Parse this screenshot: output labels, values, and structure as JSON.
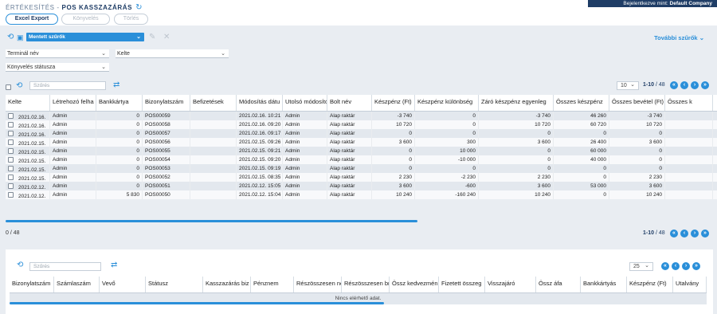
{
  "header": {
    "crumb_parent": "ÉRTÉKESÍTÉS",
    "crumb_sep": " - ",
    "crumb_current": "POS KASSZAZÁRÁS",
    "login_prefix": "Bejelentkezve mint: ",
    "login_user": "Default Company"
  },
  "toolbar": {
    "excel": "Excel Export",
    "book": "Könyvelés",
    "delete": "Törlés"
  },
  "filters": {
    "saved": "Mentett szűrők",
    "more": "További szűrők",
    "terminal": "Terminál név",
    "date": "Kelte",
    "status": "Könyvelés státusza"
  },
  "grid": {
    "search_placeholder": "Szűrés",
    "page_size": "10",
    "range": "1-10",
    "total": " / 48",
    "footer_count": "0  /  48",
    "columns": [
      "Kelte",
      "Létrehozó felha",
      "Bankkártya",
      "Bizonylatszám",
      "Befizetések",
      "Módosítás dátu",
      "Utolsó módosító",
      "Bolt név",
      "Készpénz (Ft)",
      "Készpénz különbség",
      "Záró készpénz egyenleg",
      "Összes készpénz",
      "Összes bevétel (Ft)",
      "Összes k"
    ],
    "rows": [
      [
        "2021.02.16.",
        "Admin",
        "0",
        "POS00059",
        "",
        "2021.02.16. 10:21",
        "Admin",
        "Alap raktár",
        "-3 740",
        "0",
        "-3 740",
        "46 260",
        "-3 740",
        ""
      ],
      [
        "2021.02.16.",
        "Admin",
        "0",
        "POS00058",
        "",
        "2021.02.16. 09:20",
        "Admin",
        "Alap raktár",
        "10 720",
        "0",
        "10 720",
        "60 720",
        "10 720",
        ""
      ],
      [
        "2021.02.16.",
        "Admin",
        "0",
        "POS00057",
        "",
        "2021.02.16. 09:17",
        "Admin",
        "Alap raktár",
        "0",
        "0",
        "0",
        "0",
        "0",
        ""
      ],
      [
        "2021.02.15.",
        "Admin",
        "0",
        "POS00056",
        "",
        "2021.02.15. 09:26",
        "Admin",
        "Alap raktár",
        "3 600",
        "300",
        "3 600",
        "26 400",
        "3 600",
        ""
      ],
      [
        "2021.02.15.",
        "Admin",
        "0",
        "POS00055",
        "",
        "2021.02.15. 09:21",
        "Admin",
        "Alap raktár",
        "0",
        "10 000",
        "0",
        "60 000",
        "0",
        ""
      ],
      [
        "2021.02.15.",
        "Admin",
        "0",
        "POS00054",
        "",
        "2021.02.15. 09:20",
        "Admin",
        "Alap raktár",
        "0",
        "-10 000",
        "0",
        "40 000",
        "0",
        ""
      ],
      [
        "2021.02.15.",
        "Admin",
        "0",
        "POS00053",
        "",
        "2021.02.15. 09:19",
        "Admin",
        "Alap raktár",
        "0",
        "0",
        "0",
        "0",
        "0",
        ""
      ],
      [
        "2021.02.15.",
        "Admin",
        "0",
        "POS00052",
        "",
        "2021.02.15. 08:35",
        "Admin",
        "Alap raktár",
        "2 230",
        "-2 230",
        "2 230",
        "0",
        "2 230",
        ""
      ],
      [
        "2021.02.12.",
        "Admin",
        "0",
        "POS00051",
        "",
        "2021.02.12. 15:05",
        "Admin",
        "Alap raktár",
        "3 600",
        "-600",
        "3 600",
        "53 000",
        "3 600",
        ""
      ],
      [
        "2021.02.12.",
        "Admin",
        "5 830",
        "POS00050",
        "",
        "2021.02.12. 15:04",
        "Admin",
        "Alap raktár",
        "10 240",
        "-160 240",
        "10 240",
        "0",
        "10 240",
        ""
      ]
    ]
  },
  "grid2": {
    "search_placeholder": "Szűrés",
    "page_size": "25",
    "columns": [
      "Bizonylatszám",
      "Számlaszám",
      "Vevő",
      "Státusz",
      "Kasszazárás biz",
      "Pénznem",
      "Részösszesen ne",
      "Részösszesen br",
      "Össz kedvezmén",
      "Fizetett összeg",
      "Visszajáró",
      "Össz áfa",
      "Bankkártyás",
      "Készpénz (Ft)",
      "Utalvány"
    ],
    "empty": "Nincs elérhető adat."
  },
  "colors": {
    "accent": "#2a8fd9",
    "navy": "#1f3d66"
  }
}
